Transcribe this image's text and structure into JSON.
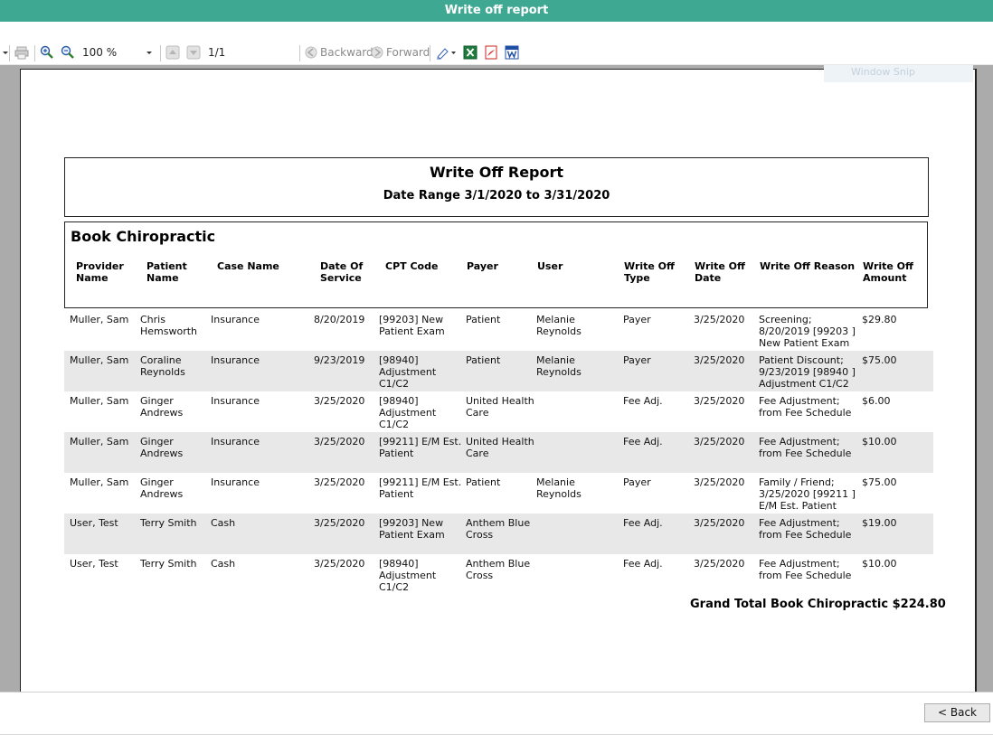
{
  "window": {
    "title": "Write off report"
  },
  "toolbar": {
    "zoom": "100 %",
    "page": "1/1",
    "backward": "Backward",
    "forward": "Forward"
  },
  "ghost_text": "Window Snip",
  "report": {
    "title": "Write Off Report",
    "date_range": "Date Range 3/1/2020 to 3/31/2020",
    "group": "Book Chiropractic",
    "columns": [
      "Provider\nName",
      "Patient\nName",
      "Case Name",
      "Date Of\nService",
      "CPT Code",
      "Payer",
      "User",
      "Write Off\nType",
      "Write Off\nDate",
      "Write Off Reason",
      "Write Off\nAmount"
    ],
    "rows": [
      [
        "Muller, Sam",
        "Chris\nHemsworth",
        "Insurance",
        "8/20/2019",
        "[99203] New\nPatient Exam",
        "Patient",
        "Melanie\nReynolds",
        "Payer",
        "3/25/2020",
        "Screening;\n8/20/2019 [99203 ]\nNew Patient Exam",
        "$29.80"
      ],
      [
        "Muller, Sam",
        "Coraline\nReynolds",
        "Insurance",
        "9/23/2019",
        "[98940]\nAdjustment\nC1/C2",
        "Patient",
        "Melanie\nReynolds",
        "Payer",
        "3/25/2020",
        "Patient Discount;\n9/23/2019 [98940 ]\nAdjustment C1/C2",
        "$75.00"
      ],
      [
        "Muller, Sam",
        "Ginger\nAndrews",
        "Insurance",
        "3/25/2020",
        "[98940]\nAdjustment\nC1/C2",
        "United Health\nCare",
        "",
        "Fee Adj.",
        "3/25/2020",
        "Fee Adjustment;\nfrom Fee Schedule",
        "$6.00"
      ],
      [
        "Muller, Sam",
        "Ginger\nAndrews",
        "Insurance",
        "3/25/2020",
        "[99211] E/M Est.\nPatient",
        "United Health\nCare",
        "",
        "Fee Adj.",
        "3/25/2020",
        "Fee Adjustment;\nfrom Fee Schedule",
        "$10.00"
      ],
      [
        "Muller, Sam",
        "Ginger\nAndrews",
        "Insurance",
        "3/25/2020",
        "[99211] E/M Est.\nPatient",
        "Patient",
        "Melanie\nReynolds",
        "Payer",
        "3/25/2020",
        "Family / Friend;\n3/25/2020 [99211 ]\nE/M Est. Patient",
        "$75.00"
      ],
      [
        "User, Test",
        "Terry Smith",
        "Cash",
        "3/25/2020",
        "[99203] New\nPatient Exam",
        "Anthem Blue\nCross",
        "",
        "Fee Adj.",
        "3/25/2020",
        "Fee Adjustment;\nfrom Fee Schedule",
        "$19.00"
      ],
      [
        "User, Test",
        "Terry Smith",
        "Cash",
        "3/25/2020",
        "[98940]\nAdjustment\nC1/C2",
        "Anthem Blue\nCross",
        "",
        "Fee Adj.",
        "3/25/2020",
        "Fee Adjustment;\nfrom Fee Schedule",
        "$10.00"
      ]
    ],
    "grand_total": "Grand Total Book Chiropractic $224.80"
  },
  "footer": {
    "back_label": "< Back"
  },
  "icons": {
    "dropdown": "dropdown-arrow-icon",
    "print": "print-icon",
    "zoom_in": "zoom-in-icon",
    "zoom_out": "zoom-out-icon",
    "prev_page": "page-up-icon",
    "next_page": "page-down-icon",
    "backward": "back-history-icon",
    "forward": "forward-history-icon",
    "highlight": "pen-icon",
    "excel": "excel-icon",
    "pdf": "pdf-icon",
    "word": "word-icon"
  }
}
